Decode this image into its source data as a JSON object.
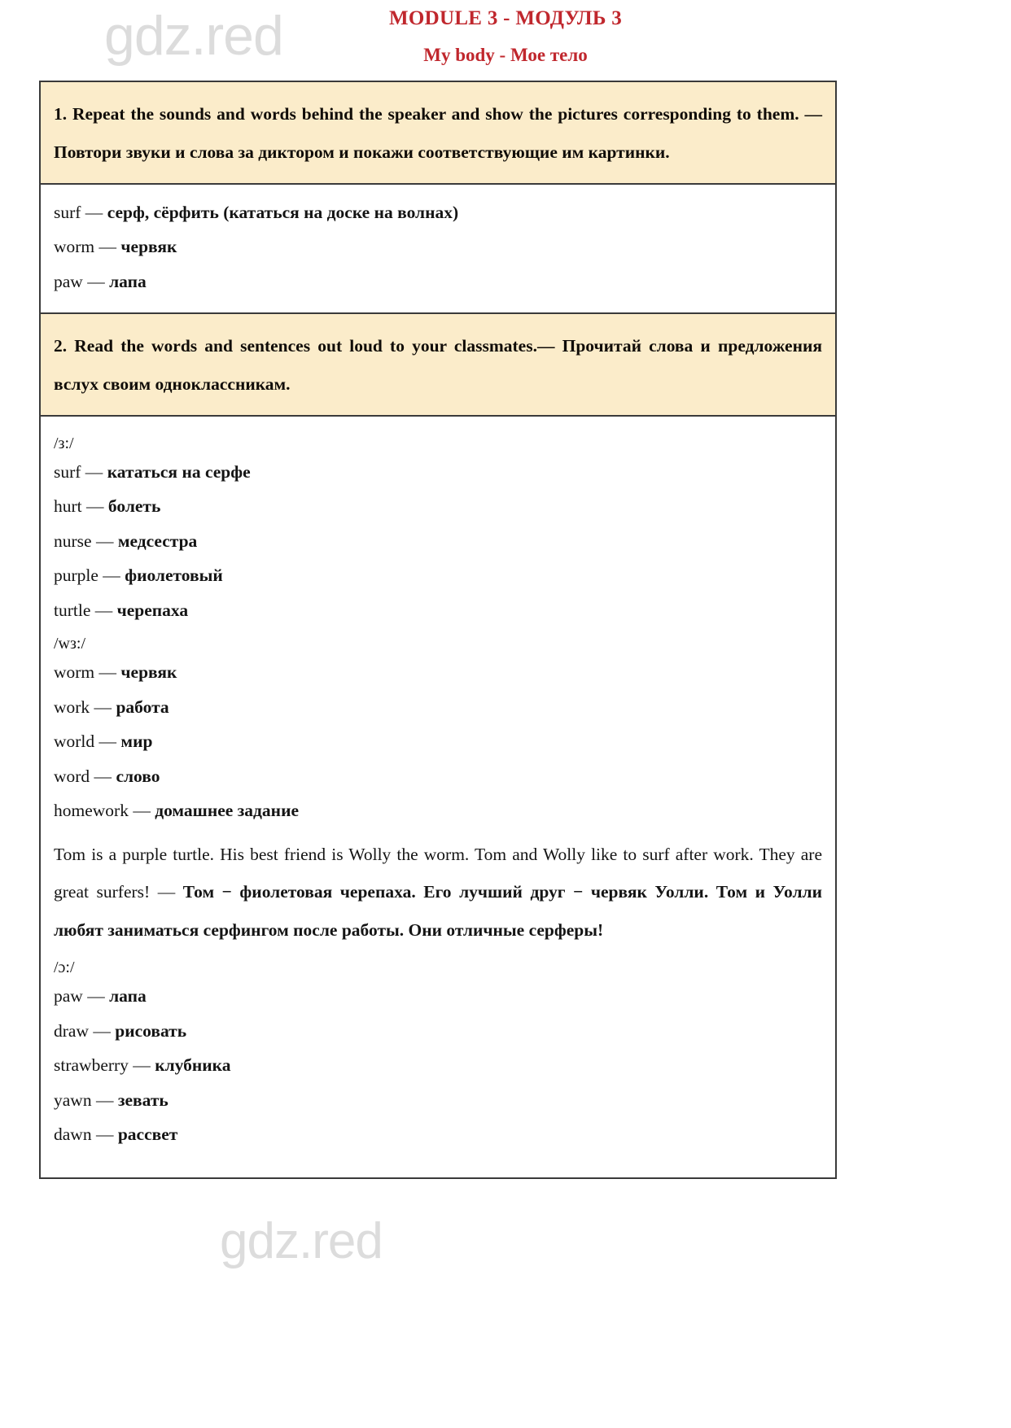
{
  "watermark": {
    "text": "gdz.red",
    "color": "#dcdcdc"
  },
  "header": {
    "module_title": "MODULE 3 - МОДУЛЬ 3",
    "unit_title": "My body - Мое тело",
    "color": "#c0272d"
  },
  "tasks": [
    {
      "number": "1.",
      "instruction": "1.  Repeat the sounds and words behind the speaker and show the pictures corresponding to them. — Повтори звуки и слова за диктором и покажи соответствующие им картинки.",
      "answers": [
        {
          "en": "surf — ",
          "ru": "серф, сёрфить (кататься на доске на волнах)"
        },
        {
          "en": "worm — ",
          "ru": "червяк"
        },
        {
          "en": "paw — ",
          "ru": "лапа"
        }
      ]
    },
    {
      "number": "2.",
      "instruction": "2. Read the words and sentences out loud to your classmates.— Прочитай слова и предложения вслух своим одноклассникам.",
      "groups": [
        {
          "phoneme": "/з:/",
          "items": [
            {
              "en": "surf — ",
              "ru": "кататься на серфе"
            },
            {
              "en": "hurt — ",
              "ru": "болеть"
            },
            {
              "en": "nurse — ",
              "ru": "медсестра"
            },
            {
              "en": "purple — ",
              "ru": "фиолетовый"
            },
            {
              "en": "turtle — ",
              "ru": "черепаха"
            }
          ]
        },
        {
          "phoneme": "/wз:/",
          "items": [
            {
              "en": "worm — ",
              "ru": "червяк"
            },
            {
              "en": "work — ",
              "ru": "работа"
            },
            {
              "en": "world — ",
              "ru": "мир"
            },
            {
              "en": "word — ",
              "ru": "слово"
            },
            {
              "en": "homework —  ",
              "ru": "домашнее задание"
            }
          ],
          "paragraph": {
            "en": "Tom is a purple turtle. His best friend is Wolly the worm. Tom and Wolly like to surf after work. They are great surfers! — ",
            "ru": "Том − фиолетовая черепаха. Его лучший друг − червяк Уолли. Том и Уолли любят заниматься серфингом после работы. Они отличные серферы!"
          }
        },
        {
          "phoneme": "/ɔ:/",
          "items": [
            {
              "en": "paw — ",
              "ru": "лапа"
            },
            {
              "en": "draw — ",
              "ru": "рисовать"
            },
            {
              "en": "strawberry — ",
              "ru": "клубника"
            },
            {
              "en": "yawn — ",
              "ru": "зевать"
            },
            {
              "en": "dawn — ",
              "ru": "рассвет"
            }
          ]
        }
      ]
    }
  ]
}
